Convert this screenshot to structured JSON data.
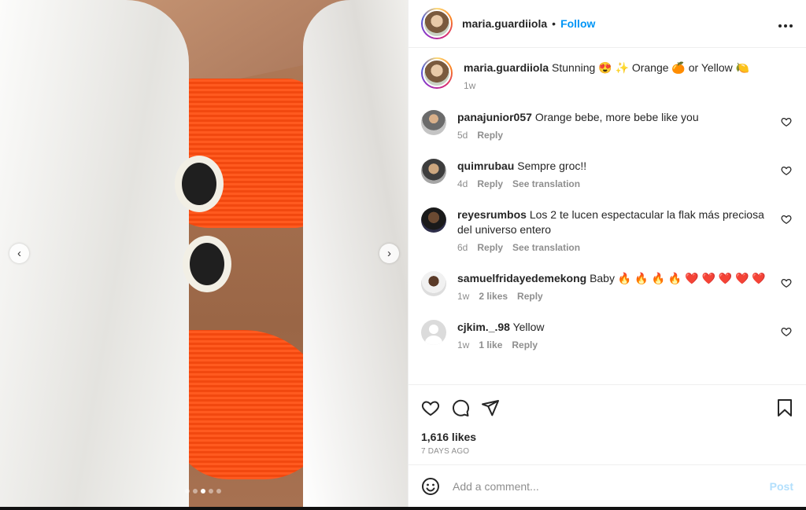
{
  "header": {
    "username": "maria.guardiiola",
    "separator": "•",
    "follow_label": "Follow",
    "more_icon": "more-horizontal-icon"
  },
  "caption": {
    "username": "maria.guardiiola",
    "text": "Stunning 😍 ✨ Orange 🍊 or Yellow 🍋",
    "time": "1w"
  },
  "comments": [
    {
      "username": "panajunior057",
      "text": "Orange bebe, more bebe like you",
      "time": "5d",
      "likes": "",
      "reply": "Reply",
      "translate": ""
    },
    {
      "username": "quimrubau",
      "text": "Sempre groc!!",
      "time": "4d",
      "likes": "",
      "reply": "Reply",
      "translate": "See translation"
    },
    {
      "username": "reyesrumbos",
      "text": "Los 2 te lucen espectacular la flak más preciosa del universo entero",
      "time": "6d",
      "likes": "",
      "reply": "Reply",
      "translate": "See translation"
    },
    {
      "username": "samuelfridayedemekong",
      "text": "Baby 🔥 🔥 🔥 🔥 ❤️ ❤️ ❤️ ❤️ ❤️",
      "time": "1w",
      "likes": "2 likes",
      "reply": "Reply",
      "translate": ""
    },
    {
      "username": "cjkim._.98",
      "text": "Yellow",
      "time": "1w",
      "likes": "1 like",
      "reply": "Reply",
      "translate": ""
    }
  ],
  "actions": {
    "likes": "1,616 likes",
    "age": "7 DAYS AGO"
  },
  "composer": {
    "placeholder": "Add a comment...",
    "post_label": "Post"
  },
  "media": {
    "prev_glyph": "‹",
    "next_glyph": "›",
    "slide_count": 5,
    "active_slide": 3
  }
}
